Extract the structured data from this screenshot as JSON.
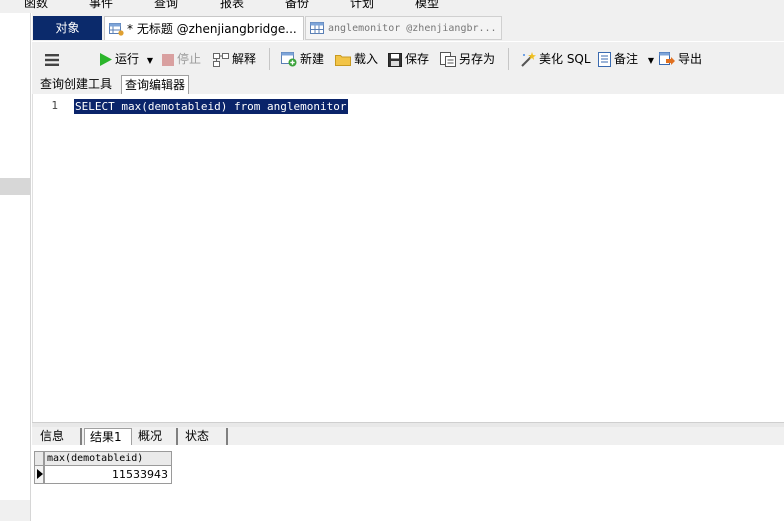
{
  "menu": [
    "函数",
    "事件",
    "查询",
    "报表",
    "备份",
    "计划",
    "模型"
  ],
  "tabs": {
    "objects": "对象",
    "query1": "* 无标题 @zhenjiangbridge...",
    "query2": "anglemonitor @zhenjiangbr..."
  },
  "toolbar": {
    "run": "运行",
    "stop": "停止",
    "explain": "解释",
    "new": "新建",
    "load": "载入",
    "save": "保存",
    "save_as": "另存为",
    "beautify": "美化 SQL",
    "note": "备注",
    "export": "导出"
  },
  "subtabs": {
    "builder": "查询创建工具",
    "editor": "查询编辑器"
  },
  "editor": {
    "line_number": "1",
    "sql": "SELECT max(demotableid) from anglemonitor"
  },
  "result_tabs": {
    "info": "信息",
    "result": "结果1",
    "overview": "概况",
    "status": "状态"
  },
  "grid": {
    "columns": [
      "max(demotableid)"
    ],
    "rows": [
      [
        "11533943"
      ]
    ]
  },
  "colors": {
    "active_tab": "#0b2a6b",
    "selection": "#0a246a",
    "run_icon": "#2bb52b"
  }
}
